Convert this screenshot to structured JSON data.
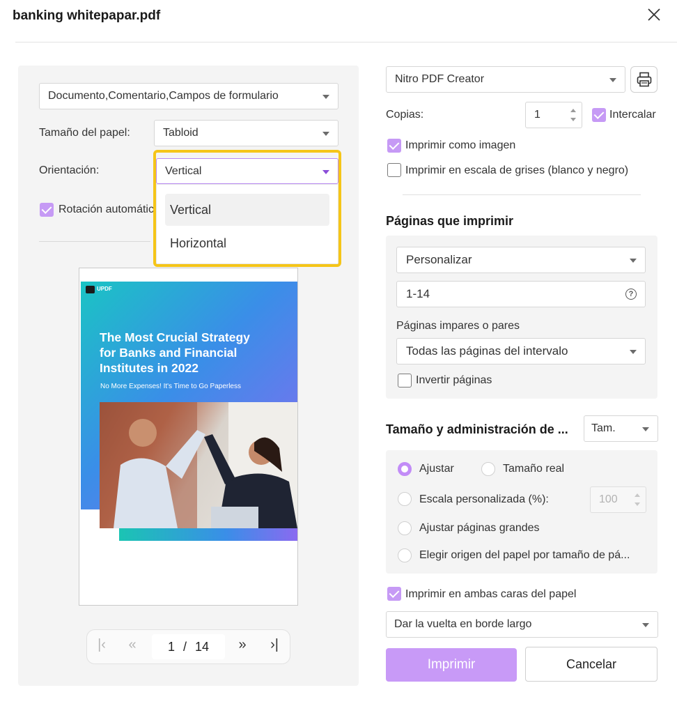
{
  "window": {
    "title": "banking whitepapar.pdf"
  },
  "left": {
    "content_select": "Documento,Comentario,Campos de formulario",
    "paper_size_label": "Tamaño del papel:",
    "paper_size_value": "Tabloid",
    "orientation_label": "Orientación:",
    "orientation_value": "Vertical",
    "orientation_options": [
      "Vertical",
      "Horizontal"
    ],
    "auto_rotate_label": "Rotación automátic"
  },
  "preview": {
    "brand": "UPDF",
    "headline": "The Most Crucial Strategy for Banks and Financial Institutes in 2022",
    "tagline": "No More Expenses! It's Time to Go Paperless"
  },
  "pager": {
    "current": "1",
    "separator": "/",
    "total": "14"
  },
  "right": {
    "printer": "Nitro PDF Creator",
    "copies_label": "Copias:",
    "copies_value": "1",
    "collate_label": "Intercalar",
    "print_as_image_label": "Imprimir como imagen",
    "grayscale_label": "Imprimir en escala de grises (blanco y negro)",
    "pages_section_title": "Páginas que imprimir",
    "pages_mode": "Personalizar",
    "pages_range": "1-14",
    "odd_even_label": "Páginas impares o pares",
    "odd_even_value": "Todas las páginas del intervalo",
    "reverse_label": "Invertir páginas",
    "size_section_title": "Tamaño y administración de ...",
    "size_select": "Tam.",
    "fit_label": "Ajustar",
    "actual_size_label": "Tamaño real",
    "custom_scale_label": "Escala personalizada (%):",
    "custom_scale_value": "100",
    "fit_large_label": "Ajustar páginas grandes",
    "paper_source_label": "Elegir origen del papel por tamaño de pá...",
    "duplex_label": "Imprimir en ambas caras del papel",
    "duplex_mode": "Dar la vuelta en borde largo",
    "print_button": "Imprimir",
    "cancel_button": "Cancelar"
  },
  "colors": {
    "accent": "#c69af5",
    "highlight": "#f5c518",
    "panel": "#f4f4f4"
  }
}
